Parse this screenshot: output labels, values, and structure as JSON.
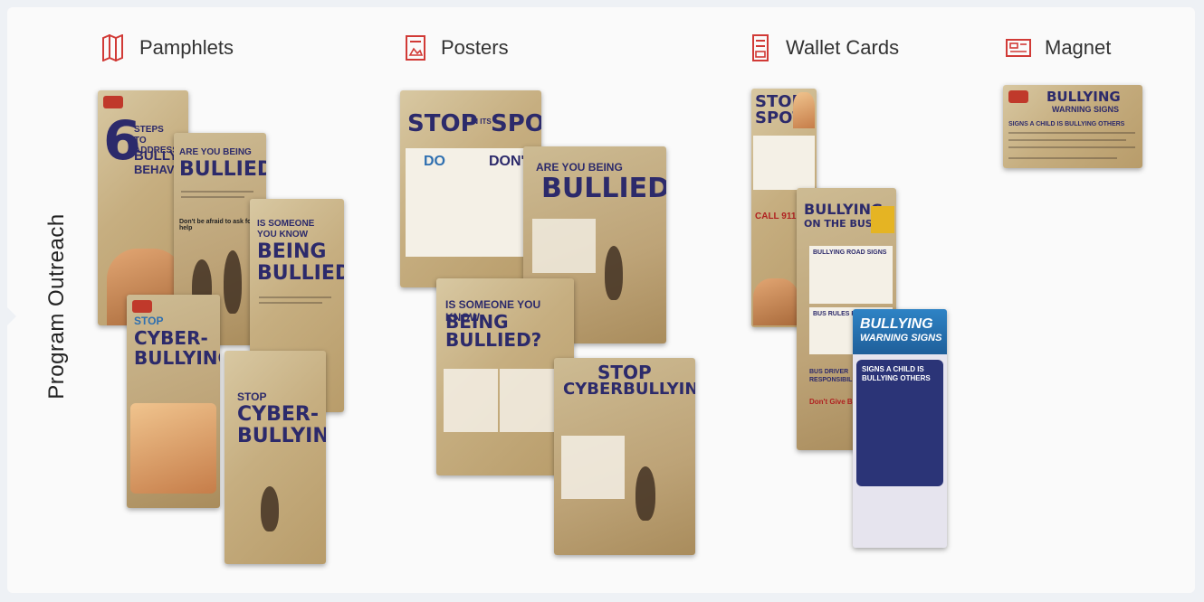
{
  "section_label": "Program Outreach",
  "categories": [
    {
      "label": "Pamphlets",
      "icon": "pamphlet-icon"
    },
    {
      "label": "Posters",
      "icon": "poster-icon"
    },
    {
      "label": "Wallet Cards",
      "icon": "wallet-card-icon"
    },
    {
      "label": "Magnet",
      "icon": "magnet-icon"
    }
  ],
  "pamphlets": {
    "p1": {
      "big": "6",
      "line1": "STEPS",
      "line2": "TO ADDRESS",
      "line3": "BULLYING",
      "line4": "BEHAVIOR"
    },
    "p2": {
      "line1": "ARE YOU BEING",
      "line2": "BULLIED?",
      "line3": "Don't be afraid to ask for help"
    },
    "p3": {
      "line1": "IS SOMEONE",
      "line2": "YOU KNOW",
      "line3": "BEING",
      "line4": "BULLIED?"
    },
    "p4": {
      "line1": "STOP",
      "line2": "CYBER-",
      "line3": "BULLYING"
    },
    "p5": {
      "line1": "STOP",
      "line2": "CYBER-",
      "line3": "BULLYING"
    }
  },
  "posters": {
    "p1": {
      "title_a": "STOP",
      "title_b": "IN ITS",
      "title_c": "SPOT",
      "col1": "DO",
      "col2": "DON'T"
    },
    "p2": {
      "line1": "ARE YOU BEING",
      "line2": "BULLIED?"
    },
    "p3": {
      "line1": "IS SOMEONE YOU KNOW",
      "line2": "BEING BULLIED?"
    },
    "p4": {
      "line1": "STOP",
      "line2": "CYBERBULLYING!"
    }
  },
  "wallet_cards": {
    "c1": {
      "line1": "STOP",
      "line2": "SPOT",
      "call": "CALL 911 IF:"
    },
    "c2": {
      "line1": "BULLYING",
      "line2": "ON THE BUS",
      "line3": "BULLYING ROAD SIGNS",
      "line4": "BUS RULES FOR P",
      "line5": "BUS DRIVER",
      "line6": "RESPONSIBILITIES",
      "line7": "Don't Give Bullying"
    },
    "c3": {
      "line1": "BULLYING",
      "line2": "WARNING SIGNS",
      "line3": "SIGNS A CHILD IS",
      "line4": "BULLYING OTHERS"
    }
  },
  "magnet": {
    "line1": "BULLYING",
    "line2": "WARNING SIGNS",
    "line3": "SIGNS A CHILD IS BULLYING OTHERS"
  },
  "colors": {
    "headline": "#2c2a6b",
    "accent_red": "#c0392b",
    "background": "#fafafa"
  }
}
